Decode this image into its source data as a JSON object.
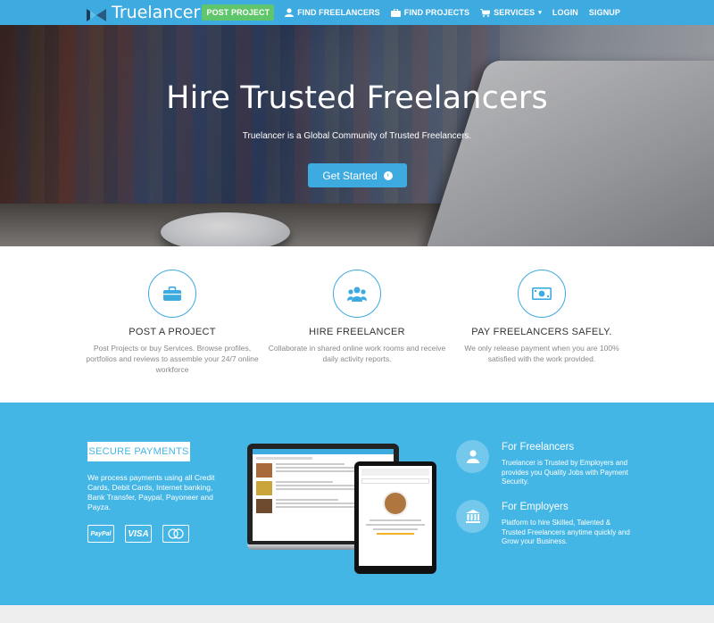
{
  "nav": {
    "brand": "Truelancer",
    "post_project": "POST PROJECT",
    "find_freelancers": "FIND FREELANCERS",
    "find_projects": "FIND PROJECTS",
    "services": "SERVICES",
    "login": "LOGIN",
    "signup": "SIGNUP"
  },
  "hero": {
    "title": "Hire Trusted Freelancers",
    "subtitle": "Truelancer is a Global Community of Trusted Freelancers.",
    "cta": "Get Started"
  },
  "features": [
    {
      "title": "POST A PROJECT",
      "description": "Post Projects or buy Services. Browse profiles, portfolios and reviews to assemble your 24/7 online workforce",
      "icon": "briefcase-icon"
    },
    {
      "title": "HIRE FREELANCER",
      "description": "Collaborate in shared online work rooms and receive daily activity reports.",
      "icon": "team-icon"
    },
    {
      "title": "PAY FREELANCERS SAFELY.",
      "description": "We only release payment when you are 100% satisfied with the work provided.",
      "icon": "money-icon"
    }
  ],
  "payments": {
    "heading": "SECURE PAYMENTS",
    "description": "We process payments using all Credit Cards, Debit Cards, Internet banking, Bank Transfer, Paypal, Payoneer and Payza.",
    "logos": [
      "PayPal",
      "VISA",
      "MasterCard"
    ]
  },
  "roles": [
    {
      "title": "For Freelancers",
      "description": "Truelancer is Trusted by Employers and provides you Quality Jobs with Payment Security.",
      "icon": "user-icon"
    },
    {
      "title": "For Employers",
      "description": "Platform to hire Skilled, Talented & Trusted Freelancers anytime quickly and Grow your Business.",
      "icon": "bank-icon"
    }
  ],
  "colors": {
    "brand_blue": "#3daae0",
    "section_blue": "#44b6e6",
    "post_green": "#60c66b"
  }
}
